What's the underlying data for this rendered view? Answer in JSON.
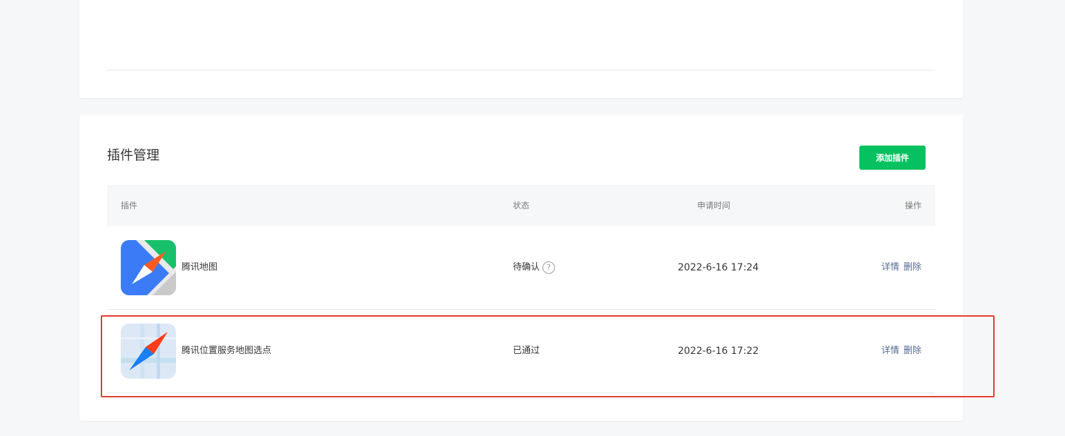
{
  "plugins_section": {
    "title": "插件管理",
    "add_button_label": "添加插件",
    "table": {
      "headers": {
        "plugin": "插件",
        "status": "状态",
        "time": "申请时间",
        "operation": "操作"
      },
      "rows": [
        {
          "name": "腾讯地图",
          "status": "待确认",
          "has_help": true,
          "help_symbol": "?",
          "time": "2022-6-16 17:24",
          "detail_label": "详情",
          "delete_label": "删除",
          "icon": "tencent-map-icon"
        },
        {
          "name": "腾讯位置服务地图选点",
          "status": "已通过",
          "has_help": false,
          "time": "2022-6-16 17:22",
          "detail_label": "详情",
          "delete_label": "删除",
          "icon": "map-picker-icon"
        }
      ]
    }
  },
  "colors": {
    "accent_green": "#07c160",
    "link_blue": "#576b95",
    "highlight_red": "#e23b2e"
  }
}
